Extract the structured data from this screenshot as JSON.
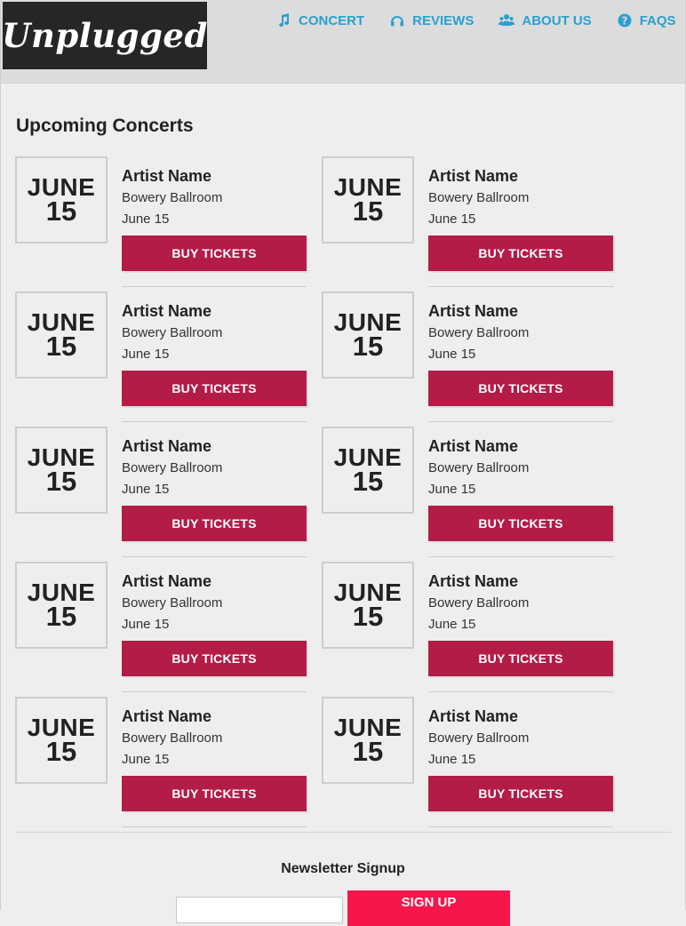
{
  "logo": {
    "text": "Unplugged"
  },
  "nav": [
    {
      "label": "CONCERT",
      "icon": "music-note-icon"
    },
    {
      "label": "REVIEWS",
      "icon": "headphones-icon"
    },
    {
      "label": "ABOUT US",
      "icon": "users-icon"
    },
    {
      "label": "FAQS",
      "icon": "question-circle-icon"
    }
  ],
  "colors": {
    "nav_link": "#2aa0d0",
    "buy_button": "#b41c48",
    "signup_button": "#f5164c",
    "logo_bg": "#262626",
    "header_bg": "#dcdcdc",
    "page_bg": "#eeeeee"
  },
  "main": {
    "title": "Upcoming Concerts"
  },
  "concerts": [
    {
      "month": "JUNE",
      "day": "15",
      "artist": "Artist Name",
      "venue": "Bowery Ballroom",
      "date": "June 15",
      "button": "BUY TICKETS"
    },
    {
      "month": "JUNE",
      "day": "15",
      "artist": "Artist Name",
      "venue": "Bowery Ballroom",
      "date": "June 15",
      "button": "BUY TICKETS"
    },
    {
      "month": "JUNE",
      "day": "15",
      "artist": "Artist Name",
      "venue": "Bowery Ballroom",
      "date": "June 15",
      "button": "BUY TICKETS"
    },
    {
      "month": "JUNE",
      "day": "15",
      "artist": "Artist Name",
      "venue": "Bowery Ballroom",
      "date": "June 15",
      "button": "BUY TICKETS"
    },
    {
      "month": "JUNE",
      "day": "15",
      "artist": "Artist Name",
      "venue": "Bowery Ballroom",
      "date": "June 15",
      "button": "BUY TICKETS"
    },
    {
      "month": "JUNE",
      "day": "15",
      "artist": "Artist Name",
      "venue": "Bowery Ballroom",
      "date": "June 15",
      "button": "BUY TICKETS"
    },
    {
      "month": "JUNE",
      "day": "15",
      "artist": "Artist Name",
      "venue": "Bowery Ballroom",
      "date": "June 15",
      "button": "BUY TICKETS"
    },
    {
      "month": "JUNE",
      "day": "15",
      "artist": "Artist Name",
      "venue": "Bowery Ballroom",
      "date": "June 15",
      "button": "BUY TICKETS"
    },
    {
      "month": "JUNE",
      "day": "15",
      "artist": "Artist Name",
      "venue": "Bowery Ballroom",
      "date": "June 15",
      "button": "BUY TICKETS"
    },
    {
      "month": "JUNE",
      "day": "15",
      "artist": "Artist Name",
      "venue": "Bowery Ballroom",
      "date": "June 15",
      "button": "BUY TICKETS"
    }
  ],
  "newsletter": {
    "title": "Newsletter Signup",
    "email_value": "",
    "button": "SIGN UP"
  }
}
